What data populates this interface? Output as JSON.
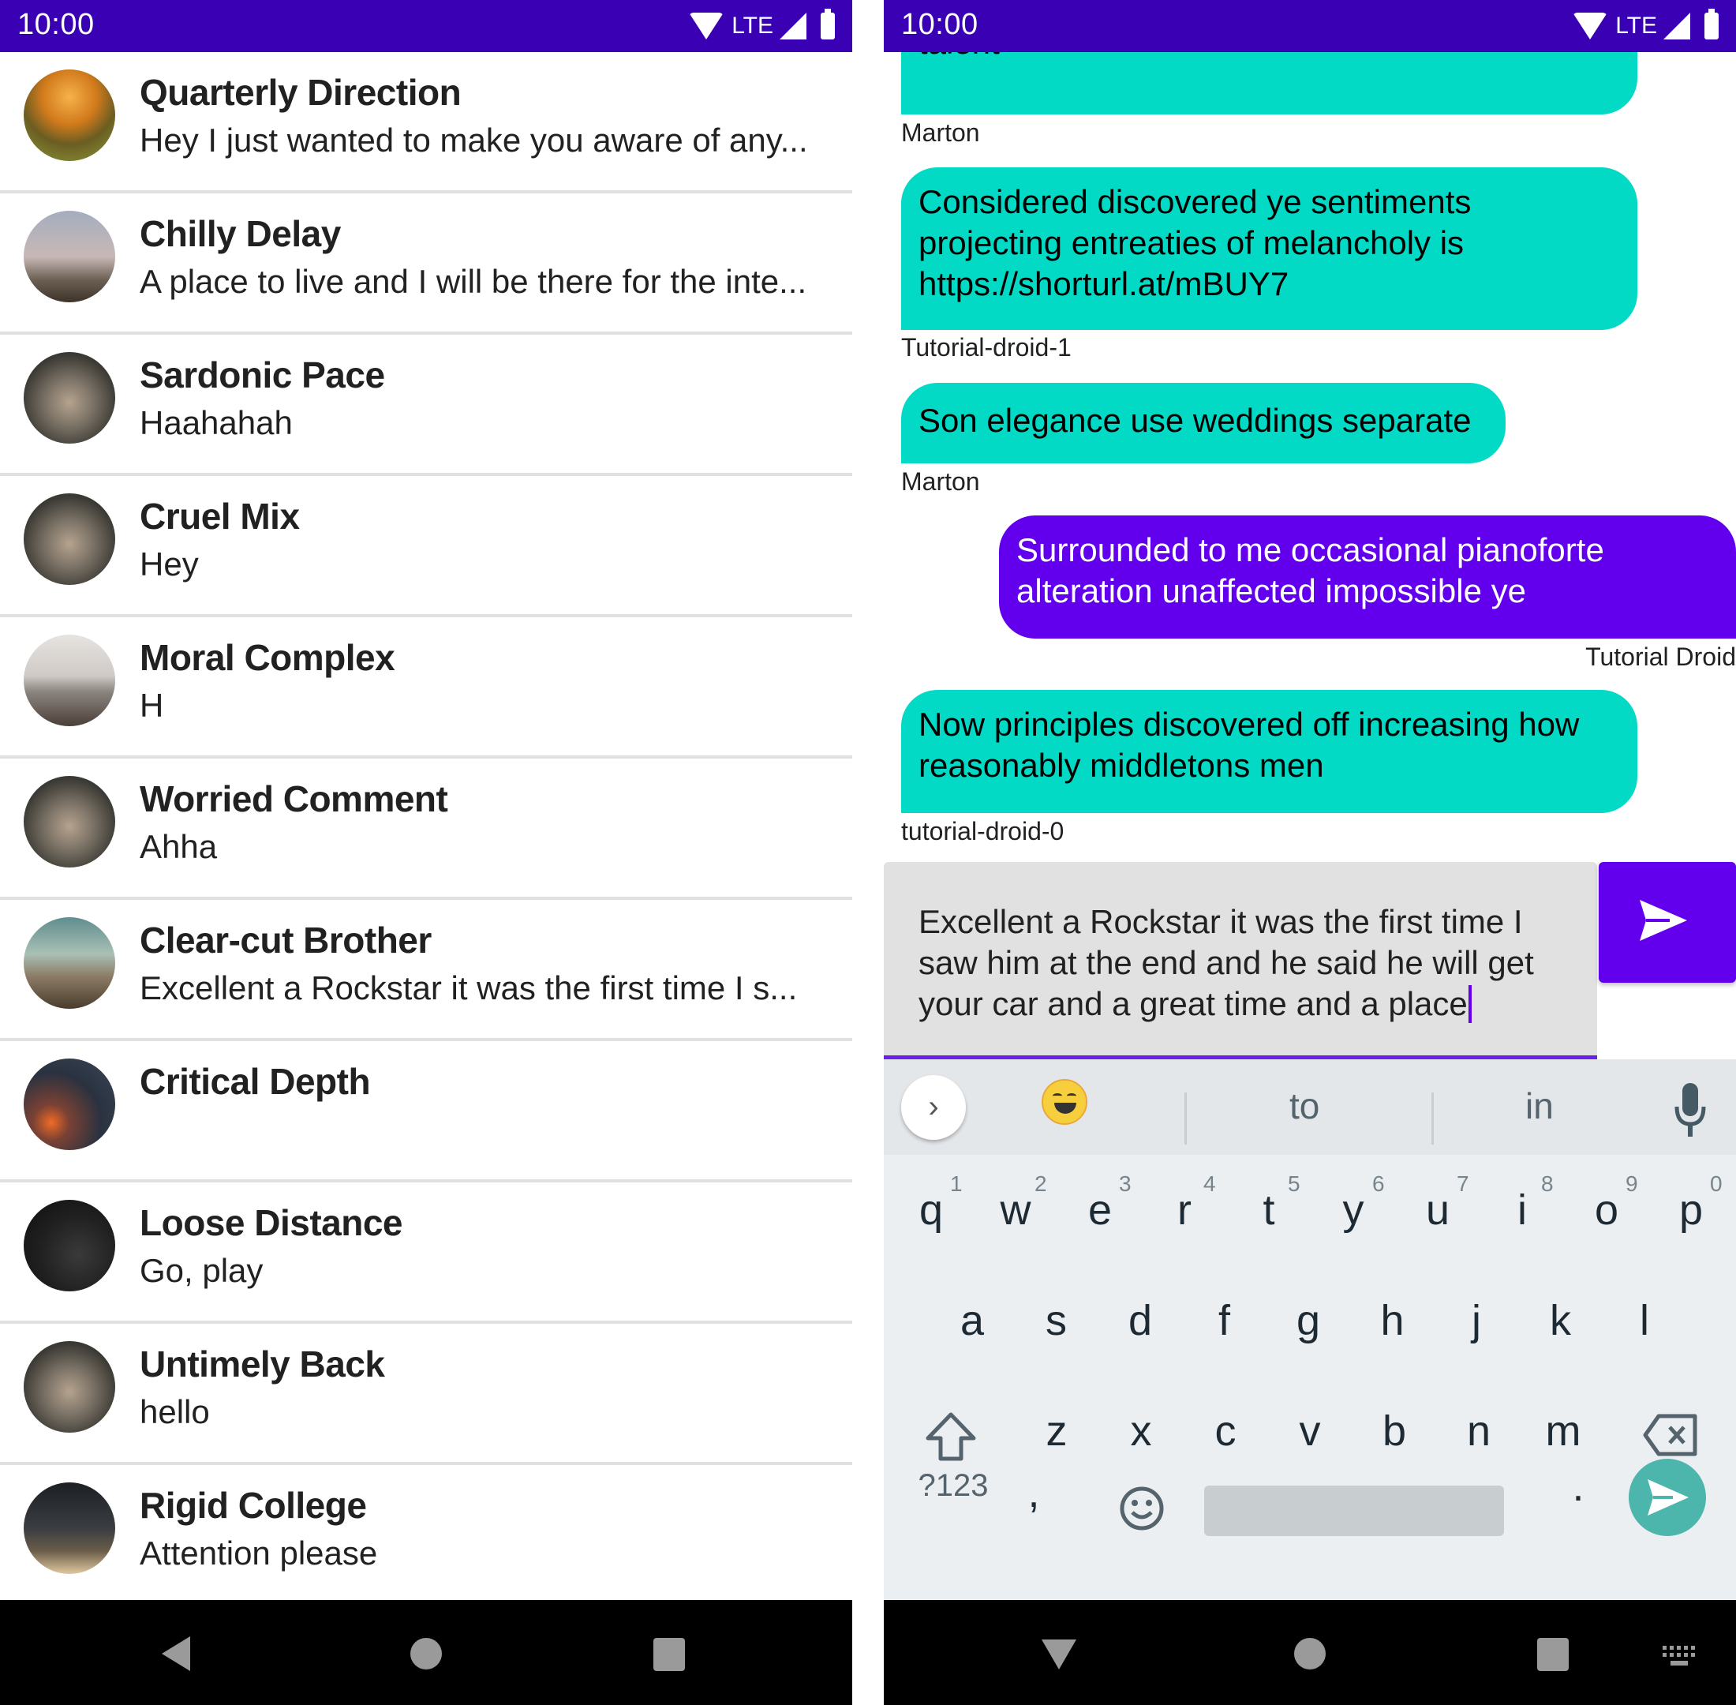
{
  "status_bar": {
    "time": "10:00",
    "network": "LTE",
    "icons": [
      "wifi-icon",
      "signal-icon",
      "battery-icon"
    ]
  },
  "colors": {
    "primary_dark": "#3a00b4",
    "primary": "#6200ee",
    "accent": "#03dac5",
    "divider": "#e0e0e0",
    "nav_bar": "#000000",
    "keyboard_bg": "#eceff1",
    "enter_key": "#4db6ac"
  },
  "conversations": [
    {
      "name": "Quarterly Direction",
      "preview": "Hey I just wanted to make you aware of any...",
      "avatar": "sunset-field-avatar"
    },
    {
      "name": "Chilly Delay",
      "preview": "A place to live and I will be there for the inte...",
      "avatar": "misty-field-avatar"
    },
    {
      "name": "Sardonic Pace",
      "preview": "Haahahah",
      "avatar": "coyote-avatar"
    },
    {
      "name": "Cruel Mix",
      "preview": "Hey",
      "avatar": "coyote-avatar"
    },
    {
      "name": "Moral Complex",
      "preview": "H",
      "avatar": "city-skyline-avatar"
    },
    {
      "name": "Worried Comment",
      "preview": "Ahha",
      "avatar": "coyote-avatar"
    },
    {
      "name": "Clear-cut Brother",
      "preview": "Excellent a Rockstar it was the first time I s...",
      "avatar": "volcano-avatar"
    },
    {
      "name": "Critical Depth",
      "preview": "",
      "avatar": "bokeh-lights-avatar"
    },
    {
      "name": "Loose Distance",
      "preview": "Go, play",
      "avatar": "dark-gorilla-avatar"
    },
    {
      "name": "Untimely Back",
      "preview": "hello",
      "avatar": "coyote-avatar"
    },
    {
      "name": "Rigid College",
      "preview": "Attention please",
      "avatar": "room-avatar"
    }
  ],
  "chat": {
    "messages": [
      {
        "text": "talent",
        "sender": "Marton",
        "direction": "incoming"
      },
      {
        "text": "Considered discovered ye sentiments projecting entreaties of melancholy is https://shorturl.at/mBUY7",
        "sender": "Tutorial-droid-1",
        "direction": "incoming"
      },
      {
        "text": "Son elegance use weddings separate",
        "sender": "Marton",
        "direction": "incoming"
      },
      {
        "text": "Surrounded to me occasional pianoforte alteration unaffected impossible ye",
        "sender": "Tutorial Droid",
        "direction": "outgoing"
      },
      {
        "text": "Now principles discovered off increasing how reasonably middletons men",
        "sender": "tutorial-droid-0",
        "direction": "incoming"
      }
    ],
    "input_value": "Excellent a Rockstar it was the first time I saw him at the end and he said he will get your car and a great time and a place",
    "send_icon": "send-icon"
  },
  "keyboard": {
    "suggestions": [
      "to",
      "in"
    ],
    "row1": [
      "q",
      "w",
      "e",
      "r",
      "t",
      "y",
      "u",
      "i",
      "o",
      "p"
    ],
    "row1_hints": [
      "1",
      "2",
      "3",
      "4",
      "5",
      "6",
      "7",
      "8",
      "9",
      "0"
    ],
    "row2": [
      "a",
      "s",
      "d",
      "f",
      "g",
      "h",
      "j",
      "k",
      "l"
    ],
    "row3": [
      "z",
      "x",
      "c",
      "v",
      "b",
      "n",
      "m"
    ],
    "symbols_key": "?123",
    "comma_key": ",",
    "period_key": "."
  },
  "nav": {
    "left": [
      "back-icon",
      "home-icon",
      "recents-icon"
    ],
    "right": [
      "hide-keyboard-icon",
      "home-icon",
      "recents-icon",
      "keyboard-switch-icon"
    ]
  }
}
